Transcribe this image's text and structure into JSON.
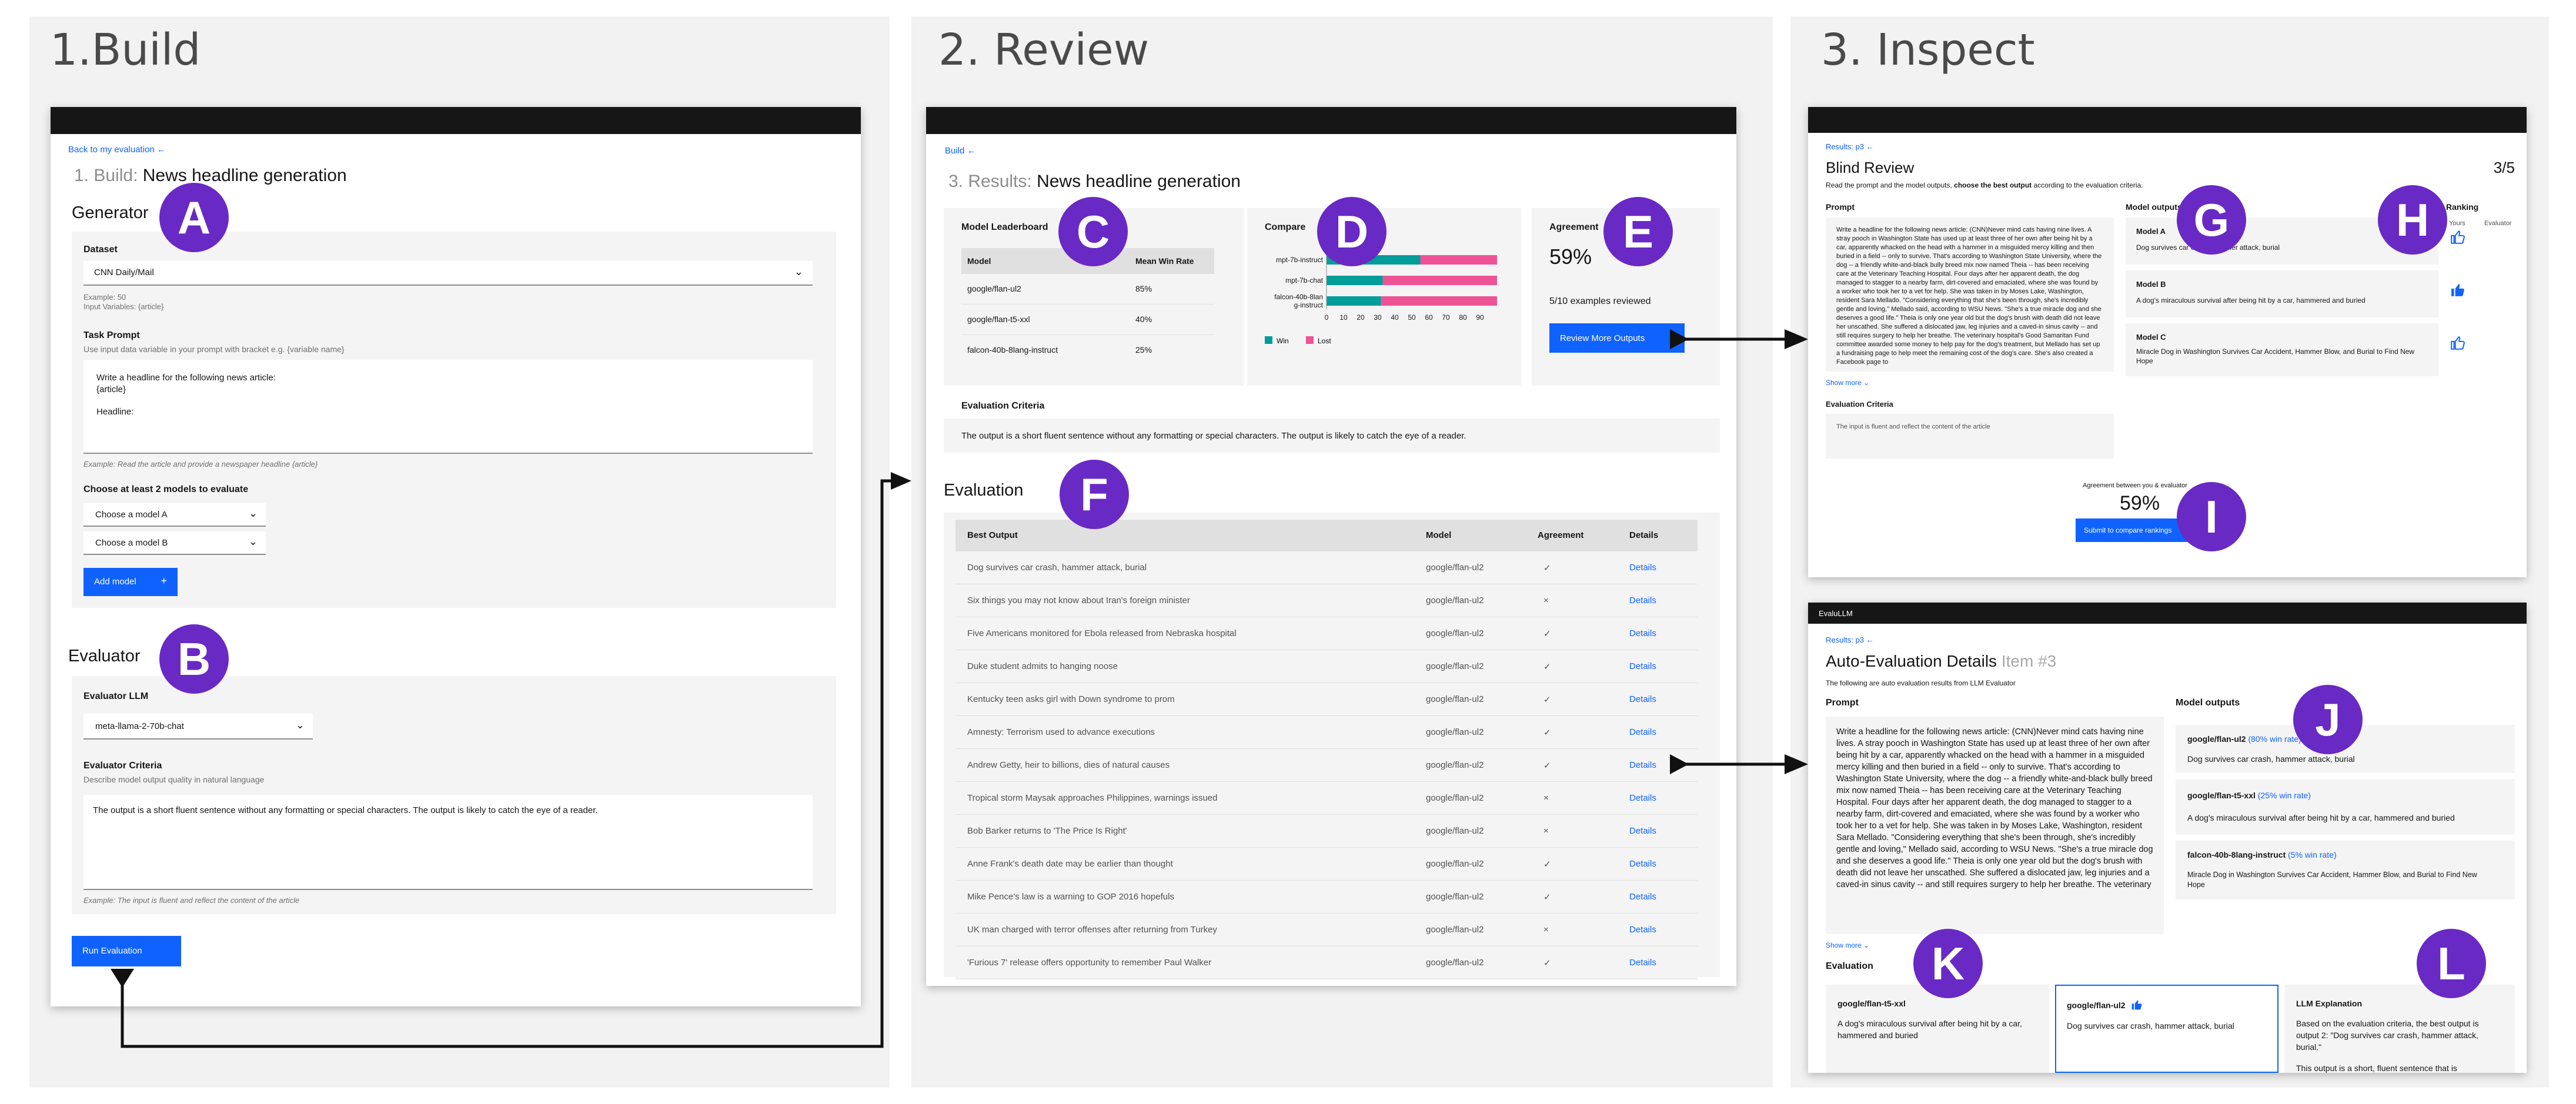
{
  "panels": {
    "build": "1.Build",
    "review": "2. Review",
    "inspect": "3. Inspect"
  },
  "badges": [
    "A",
    "B",
    "C",
    "D",
    "E",
    "F",
    "G",
    "H",
    "I",
    "J",
    "K",
    "L"
  ],
  "build": {
    "back_link": "Back to my evaluation",
    "step": "1. Build:",
    "title": "News headline generation",
    "generator": "Generator",
    "dataset_label": "Dataset",
    "dataset_value": "CNN Daily/Mail",
    "example_count": "Example: 50",
    "input_vars": "Input Variables: {article}",
    "task_prompt_label": "Task Prompt",
    "task_prompt_hint": "Use input data variable in your prompt with bracket e.g. {variable name}",
    "prompt_line1": "Write a headline for the following news article:",
    "prompt_line2": "{article}",
    "prompt_line3": "Headline:",
    "prompt_example": "Example: Read the article and provide a newspaper headline {article}",
    "choose_models": "Choose at least 2 models to evaluate",
    "model_a": "Choose a model A",
    "model_b": "Choose a model B",
    "add_model": "Add model",
    "evaluator": "Evaluator",
    "evaluator_llm": "Evaluator LLM",
    "evaluator_model": "meta-llama-2-70b-chat",
    "evaluator_criteria": "Evaluator Criteria",
    "criteria_hint": "Describe model output quality in natural language",
    "criteria_text": "The output is a short fluent sentence without any formatting or special characters. The output is likely to catch the eye of a reader.",
    "criteria_example": "Example: The input is fluent and reflect the content of the article",
    "run": "Run Evaluation"
  },
  "review": {
    "breadcrumb": "Build",
    "step": "3. Results:",
    "title": "News headline generation",
    "leaderboard_title": "Model Leaderboard",
    "leaderboard_cols": [
      "Model",
      "Mean Win Rate"
    ],
    "leaderboard": [
      [
        "google/flan-ul2",
        "85%"
      ],
      [
        "google/flan-t5-xxl",
        "40%"
      ],
      [
        "falcon-40b-8lang-instruct",
        "25%"
      ]
    ],
    "compare_title": "Compare",
    "compare_labels": [
      "mpt-7b-instruct",
      "mpt-7b-chat",
      "falcon-40b-8lan\ng-instruct"
    ],
    "compare_ticks": [
      "0",
      "10",
      "20",
      "30",
      "40",
      "50",
      "60",
      "70",
      "80",
      "90"
    ],
    "legend_win": "Win",
    "legend_lost": "Lost",
    "agreement_title": "Agreement",
    "agreement_value": "59%",
    "reviewed": "5/10 examples reviewed",
    "review_more": "Review More Outputs",
    "criteria_title": "Evaluation Criteria",
    "criteria_text": "The output is a short fluent sentence without any formatting or special characters. The output is likely to catch the eye of a reader.",
    "evaluation_title": "Evaluation",
    "eval_cols": [
      "Best Output",
      "Model",
      "Agreement",
      "Details"
    ],
    "rows": [
      {
        "output": "Dog survives car crash, hammer attack, burial",
        "model": "google/flan-ul2",
        "agree": "✓",
        "details": "Details"
      },
      {
        "output": "Six things you may not know about Iran's foreign minister",
        "model": "google/flan-ul2",
        "agree": "×",
        "details": "Details"
      },
      {
        "output": "Five Americans monitored for Ebola released from Nebraska hospital",
        "model": "google/flan-ul2",
        "agree": "✓",
        "details": "Details"
      },
      {
        "output": "Duke student admits to hanging noose",
        "model": "google/flan-ul2",
        "agree": "✓",
        "details": "Details"
      },
      {
        "output": "Kentucky teen asks girl with Down syndrome to prom",
        "model": "google/flan-ul2",
        "agree": "✓",
        "details": "Details"
      },
      {
        "output": "Amnesty: Terrorism used to advance executions",
        "model": "google/flan-ul2",
        "agree": "✓",
        "details": "Details"
      },
      {
        "output": "Andrew Getty, heir to billions, dies of natural causes",
        "model": "google/flan-ul2",
        "agree": "✓",
        "details": "Details"
      },
      {
        "output": "Tropical storm Maysak approaches Philippines, warnings issued",
        "model": "google/flan-ul2",
        "agree": "×",
        "details": "Details"
      },
      {
        "output": "Bob Barker returns to 'The Price Is Right'",
        "model": "google/flan-ul2",
        "agree": "×",
        "details": "Details"
      },
      {
        "output": "Anne Frank's death date may be earlier than thought",
        "model": "google/flan-ul2",
        "agree": "✓",
        "details": "Details"
      },
      {
        "output": "Mike Pence's law is a warning to GOP 2016 hopefuls",
        "model": "google/flan-ul2",
        "agree": "✓",
        "details": "Details"
      },
      {
        "output": "UK man charged with terror offenses after returning from Turkey",
        "model": "google/flan-ul2",
        "agree": "×",
        "details": "Details"
      },
      {
        "output": "'Furious 7' release offers opportunity to remember Paul Walker",
        "model": "google/flan-ul2",
        "agree": "✓",
        "details": "Details"
      }
    ]
  },
  "chart_data": {
    "type": "bar",
    "categories": [
      "mpt-7b-instruct",
      "mpt-7b-chat",
      "falcon-40b-8lang-instruct"
    ],
    "series": [
      {
        "name": "Win",
        "values": [
          55,
          33,
          32
        ]
      },
      {
        "name": "Lost",
        "values": [
          45,
          67,
          68
        ]
      }
    ],
    "xlim": [
      0,
      100
    ],
    "stacked": true,
    "colors": {
      "Win": "#009d9a",
      "Lost": "#ee5396"
    }
  },
  "blind": {
    "breadcrumb": "Results: p3",
    "title": "Blind Review",
    "counter": "3/5",
    "instruction_pre": "Read the prompt and the model outputs, ",
    "instruction_bold": "choose the best output",
    "instruction_post": " according to the evaluation criteria.",
    "prompt_label": "Prompt",
    "prompt_text": "Write a headline for the following news article: (CNN)Never mind cats having nine lives. A stray pooch in Washington State has used up at least three of her own after being hit by a car, apparently whacked on the head with a hammer in a misguided mercy killing and then buried in a field -- only to survive. That's according to Washington State University, where the dog -- a friendly white-and-black bully breed mix now named Theia -- has been receiving care at the Veterinary Teaching Hospital. Four days after her apparent death, the dog managed to stagger to a nearby farm, dirt-covered and emaciated, where she was found by a worker who took her to a vet for help. She was taken in by Moses Lake, Washington, resident Sara Mellado. \"Considering everything that she's been through, she's incredibly gentle and loving,\" Mellado said, according to WSU News. \"She's a true miracle dog and she deserves a good life.\" Theia is only one year old but the dog's brush with death did not leave her unscathed. She suffered a dislocated jaw, leg injuries and a caved-in sinus cavity -- and still requires surgery to help her breathe. The veterinary hospital's Good Samaritan Fund committee awarded some money to help pay for the dog's treatment, but Mellado has set up a fundraising page to help meet the remaining cost of the dog's care. She's also created a Facebook page to",
    "show_more": "Show more",
    "criteria_label": "Evaluation Criteria",
    "criteria_text": "The input is fluent and reflect the content of the article",
    "outputs_label": "Model outputs",
    "ranking_label": "Ranking",
    "ranking_yours": "Yours",
    "ranking_evaluator": "Evaluator",
    "outputs": [
      {
        "name": "Model A",
        "text": "Dog survives car crash, hammer attack, burial"
      },
      {
        "name": "Model B",
        "text": "A dog's miraculous survival after being hit by a car, hammered and buried"
      },
      {
        "name": "Model C",
        "text": "Miracle Dog in Washington Survives Car Accident, Hammer Blow, and Burial to Find New Hope"
      }
    ],
    "agreement_label": "Agreement between you & evaluator",
    "agreement_value": "59%",
    "submit": "Submit to compare rankings"
  },
  "auto": {
    "app": "EvaluLLM",
    "breadcrumb": "Results: p3",
    "title": "Auto-Evaluation Details",
    "item": "Item #3",
    "subtitle": "The following are auto evaluation results from LLM Evaluator",
    "prompt_label": "Prompt",
    "prompt_text": "Write a headline for the following news article: (CNN)Never mind cats having nine lives. A stray pooch in Washington State has used up at least three of her own after being hit by a car, apparently whacked on the head with a hammer in a misguided mercy killing and then buried in a field -- only to survive. That's according to Washington State University, where the dog -- a friendly white-and-black bully breed mix now named Theia -- has been receiving care at the Veterinary Teaching Hospital. Four days after her apparent death, the dog managed to stagger to a nearby farm, dirt-covered and emaciated, where she was found by a worker who took her to a vet for help. She was taken in by Moses Lake, Washington, resident Sara Mellado. \"Considering everything that she's been through, she's incredibly gentle and loving,\" Mellado said, according to WSU News. \"She's a true miracle dog and she deserves a good life.\" Theia is only one year old but the dog's brush with death did not leave her unscathed. She suffered a dislocated jaw, leg injuries and a caved-in sinus cavity -- and still requires surgery to help her breathe. The veterinary",
    "show_more": "Show more",
    "outputs_label": "Model outputs",
    "outputs": [
      {
        "name": "google/flan-ul2",
        "rate": "(80% win rate)",
        "text": "Dog survives car crash, hammer attack, burial"
      },
      {
        "name": "google/flan-t5-xxl",
        "rate": "(25% win rate)",
        "text": "A dog's miraculous survival after being hit by a car, hammered and buried"
      },
      {
        "name": "falcon-40b-8lang-instruct",
        "rate": "(5% win rate)",
        "text": "Miracle Dog in Washington Survives Car Accident, Hammer Blow, and Burial to Find New Hope"
      }
    ],
    "evaluation_label": "Evaluation",
    "eval_left_name": "google/flan-t5-xxl",
    "eval_left_text": "A dog's miraculous survival after being hit by a car, hammered and buried",
    "eval_mid_name": "google/flan-ul2",
    "eval_mid_text": "Dog survives car crash, hammer attack, burial",
    "explanation_label": "LLM Explanation",
    "explanation_text": "Based on the evaluation criteria, the best output is output 2: \"Dog survives car crash, hammer attack, burial.\"",
    "explanation_more": "This output is a short, fluent sentence that is"
  }
}
